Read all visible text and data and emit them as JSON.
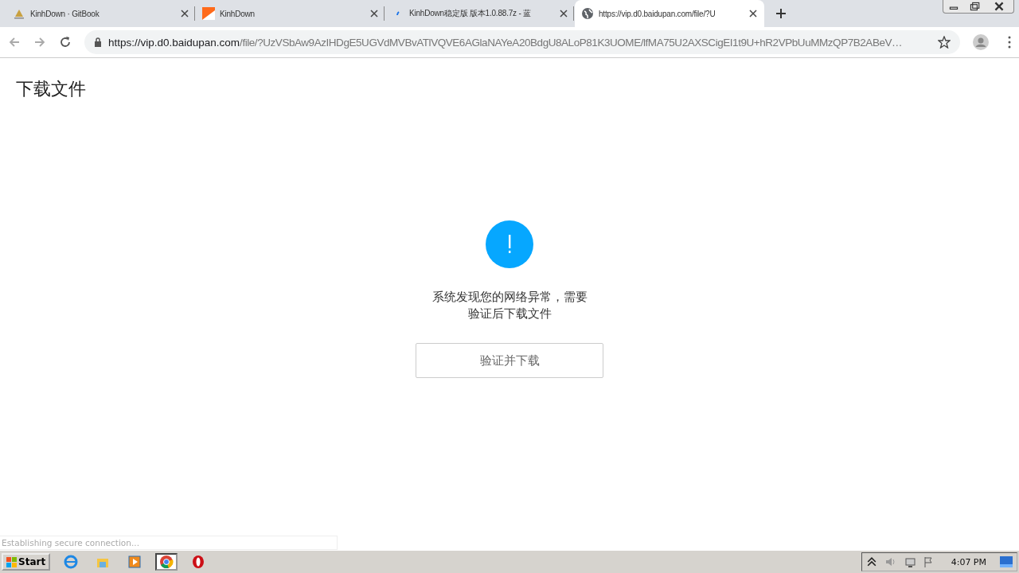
{
  "tabs": [
    {
      "title": "KinhDown · GitBook",
      "selected": false
    },
    {
      "title": "KinhDown",
      "selected": false
    },
    {
      "title": "KinhDown稳定版 版本1.0.88.7z - 蓝",
      "selected": false
    },
    {
      "title": "https://vip.d0.baidupan.com/file/?U",
      "selected": true
    }
  ],
  "address_bar": {
    "host": "https://vip.d0.baidupan.com",
    "path": "/file/?UzVSbAw9AzIHDgE5UGVdMVBvATlVQVE6AGlaNAYeA20BdgU8ALoP81K3UOME/lfMA75U2AXSCigEI1t9U+hR2VPbUuMMzQP7B2ABeV…"
  },
  "page": {
    "heading": "下载文件",
    "message_lines": [
      "系统发现您的网络异常，需要",
      "验证后下载文件"
    ],
    "button": "验证并下载"
  },
  "status_bubble": "Establishing secure connection...",
  "taskbar": {
    "start": "Start",
    "apps": [
      {
        "kind": "ie",
        "selected": false
      },
      {
        "kind": "explorer",
        "selected": false
      },
      {
        "kind": "media",
        "selected": false
      },
      {
        "kind": "chrome",
        "selected": true
      },
      {
        "kind": "opera",
        "selected": false
      }
    ],
    "clock": "4:07 PM"
  }
}
